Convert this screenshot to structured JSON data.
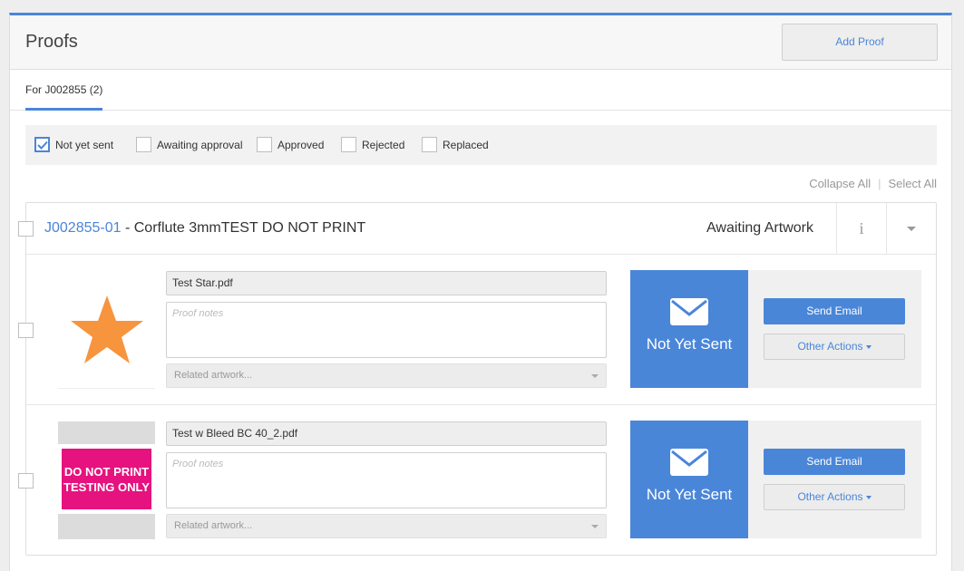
{
  "header": {
    "title": "Proofs",
    "add_proof_label": "Add Proof"
  },
  "tabs": [
    {
      "label": "For J002855 (2)",
      "active": true
    }
  ],
  "filters": [
    {
      "label": "Not yet sent",
      "checked": true
    },
    {
      "label": "Awaiting approval",
      "checked": false
    },
    {
      "label": "Approved",
      "checked": false
    },
    {
      "label": "Rejected",
      "checked": false
    },
    {
      "label": "Replaced",
      "checked": false
    }
  ],
  "links": {
    "collapse_all": "Collapse All",
    "separator": "|",
    "select_all": "Select All"
  },
  "job": {
    "code": "J002855-01",
    "title": " - Corflute 3mmTEST DO NOT PRINT",
    "status": "Awaiting Artwork",
    "info_symbol": "i"
  },
  "proofs": [
    {
      "thumbnail": "star-thumbnail",
      "file_name": "Test Star.pdf",
      "notes_placeholder": "Proof notes",
      "related_placeholder": "Related artwork...",
      "status": "Not Yet Sent",
      "send_email_label": "Send Email",
      "other_actions_label": "Other Actions"
    },
    {
      "thumbnail": "do-not-print-thumbnail",
      "thumbnail_text": [
        "DO NOT PRINT",
        "TESTING ONLY"
      ],
      "file_name": "Test w Bleed BC 40_2.pdf",
      "notes_placeholder": "Proof notes",
      "related_placeholder": "Related artwork...",
      "status": "Not Yet Sent",
      "send_email_label": "Send Email",
      "other_actions_label": "Other Actions"
    }
  ],
  "colors": {
    "accent": "#4a86d8",
    "star": "#f7943e",
    "pink": "#e6127f"
  },
  "icons": [
    "checkmark-icon",
    "info-icon",
    "chevron-down-icon",
    "envelope-icon",
    "star-icon"
  ]
}
